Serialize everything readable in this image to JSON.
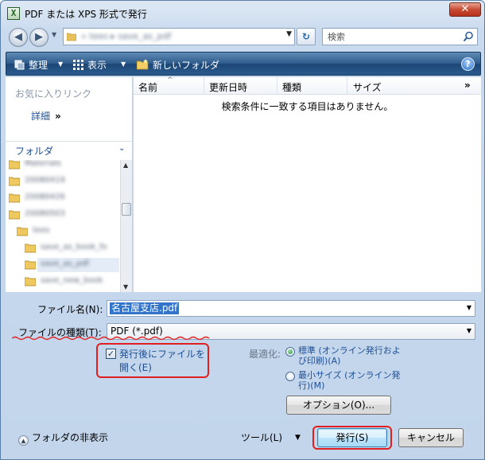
{
  "window": {
    "app_icon_glyph": "X",
    "title": "PDF または XPS 形式で発行",
    "close_glyph": "✕"
  },
  "nav": {
    "back_glyph": "◀",
    "forward_glyph": "▶",
    "history_glyph": "▼",
    "address_path": "« tees ▸ save_as_pdf",
    "address_dropdown_glyph": "▼",
    "refresh_glyph": "↻",
    "search_placeholder": "検索"
  },
  "toolbar": {
    "organize_label": "整理",
    "views_label": "表示",
    "new_folder_label": "新しいフォルダ",
    "caret_glyph": "▼",
    "help_glyph": "?"
  },
  "left_pane": {
    "favorites_heading": "お気に入りリンク",
    "details_link": "詳細",
    "details_chevron": "»",
    "folders_heading": "フォルダ",
    "folders_caret": "⌄",
    "tree": [
      {
        "label": "Materials",
        "indent": 0,
        "selected": false
      },
      {
        "label": "20080419",
        "indent": 0,
        "selected": false
      },
      {
        "label": "20080426",
        "indent": 0,
        "selected": false
      },
      {
        "label": "20080503",
        "indent": 0,
        "selected": false
      },
      {
        "label": "tees",
        "indent": 1,
        "selected": false
      },
      {
        "label": "save_as_book_fo",
        "indent": 2,
        "selected": false
      },
      {
        "label": "save_as_pdf",
        "indent": 2,
        "selected": true
      },
      {
        "label": "save_new_book",
        "indent": 2,
        "selected": false
      }
    ],
    "scroll_up": "▲",
    "scroll_down": "▼"
  },
  "file_list": {
    "columns": [
      "名前",
      "更新日時",
      "種類",
      "サイズ"
    ],
    "sort_caret": "^",
    "more_columns": "»",
    "empty_message": "検索条件に一致する項目はありません。"
  },
  "form": {
    "filename_label": "ファイル名(N):",
    "filename_value": "名古屋支店.pdf",
    "filetype_label": "ファイルの種類(T):",
    "filetype_value": "PDF (*.pdf)",
    "dropdown_glyph": "▼",
    "open_after_checked": true,
    "check_glyph": "✓",
    "open_after_line1": "発行後にファイルを",
    "open_after_line2": "開く(E)",
    "optimize_label": "最適化:",
    "radio_standard_line1": "標準 (オンライン発行およ",
    "radio_standard_line2": "び印刷)(A)",
    "radio_minimum_line1": "最小サイズ (オンライン発",
    "radio_minimum_line2": "行)(M)",
    "options_button": "オプション(O)...",
    "hide_folders_glyph": "▲",
    "hide_folders_label": "フォルダの非表示",
    "tools_label": "ツール(L)",
    "tools_caret": "▼",
    "publish_button": "発行(S)",
    "cancel_button": "キャンセル"
  },
  "colors": {
    "accent_link": "#1e4f95",
    "toolbar_bg": "#2d5a8a",
    "highlight_ring": "#e02020",
    "selection": "#3174c9"
  }
}
